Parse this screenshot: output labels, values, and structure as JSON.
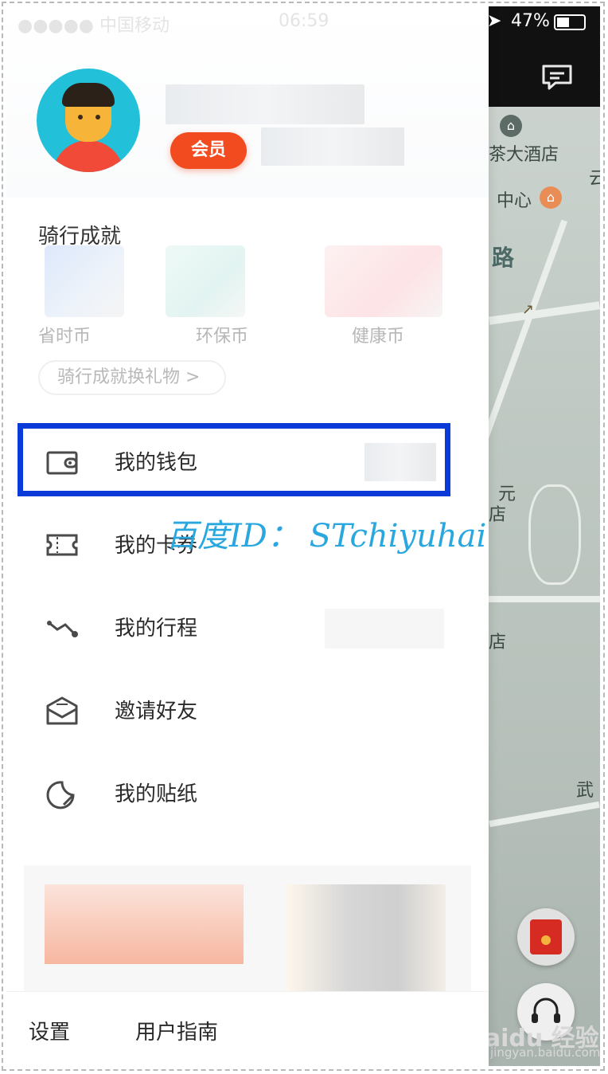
{
  "status_bar": {
    "carrier": "●●●●● 中国移动",
    "time": "06:59",
    "battery": "47%",
    "battery_level": 0.47
  },
  "profile": {
    "vip_badge": "会员"
  },
  "achievements": {
    "title": "骑行成就",
    "coins": [
      {
        "label": "省时币"
      },
      {
        "label": "环保币"
      },
      {
        "label": "健康币"
      }
    ],
    "exchange_button": "骑行成就换礼物 >"
  },
  "menu": [
    {
      "label": "我的钱包",
      "icon": "wallet-icon"
    },
    {
      "label": "我的卡券",
      "icon": "ticket-icon"
    },
    {
      "label": "我的行程",
      "icon": "route-icon"
    },
    {
      "label": "邀请好友",
      "icon": "invite-envelope-icon"
    },
    {
      "label": "我的贴纸",
      "icon": "sticker-icon"
    }
  ],
  "watermark_text": "百度ID：  STchiyuhai",
  "bottom": {
    "settings": "设置",
    "guide": "用户指南"
  },
  "map": {
    "labels": [
      "茶大酒店",
      "中心",
      "路",
      "云",
      "元",
      "店",
      "店",
      "武"
    ]
  },
  "site_watermark": {
    "brand": "Baidu 经验",
    "url": "jingyan.baidu.com"
  },
  "colors": {
    "vip": "#f24b20",
    "highlight_border": "#0a3bd9",
    "watermark": "#2aa7de"
  }
}
